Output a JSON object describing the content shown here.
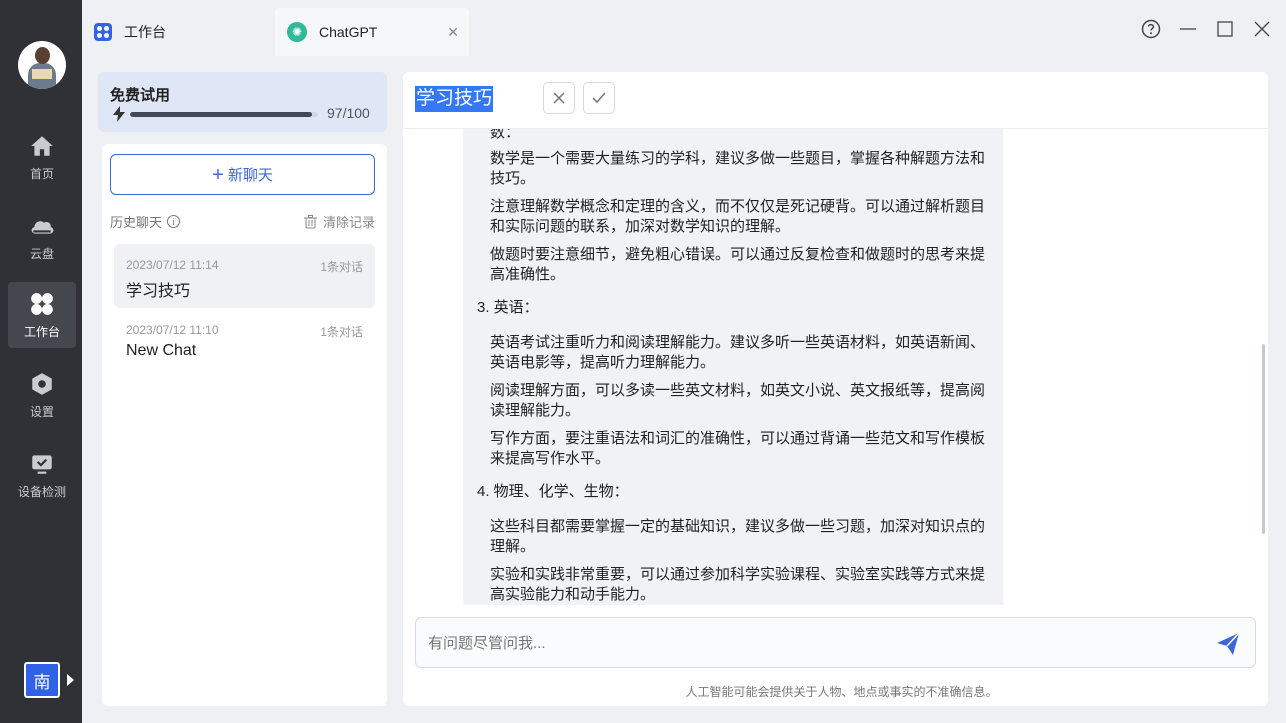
{
  "nav": {
    "items": [
      {
        "label": "首页",
        "icon": "home-icon"
      },
      {
        "label": "云盘",
        "icon": "cloud-icon"
      },
      {
        "label": "工作台",
        "icon": "workbench-icon"
      },
      {
        "label": "设置",
        "icon": "settings-icon"
      },
      {
        "label": "设备检测",
        "icon": "device-check-icon"
      }
    ],
    "active": "工作台",
    "bottom_badge": "南"
  },
  "tabs": [
    {
      "label": "工作台",
      "icon": "workbench-icon"
    },
    {
      "label": "ChatGPT",
      "icon": "chatgpt-icon"
    }
  ],
  "trial": {
    "title": "免费试用",
    "count": "97/100",
    "progress": 0.97
  },
  "chatlist": {
    "new_chat": "新聊天",
    "history_label": "历史聊天",
    "clear_label": "清除记录",
    "conversations": [
      {
        "date": "2023/07/12 11:14",
        "count": "1条对话",
        "name": "学习技巧"
      },
      {
        "date": "2023/07/12 11:10",
        "count": "1条对话",
        "name": "New Chat"
      }
    ]
  },
  "main": {
    "title": "学习技巧",
    "messages": {
      "cut_top": "数：",
      "p1": "数学是一个需要大量练习的学科，建议多做一些题目，掌握各种解题方法和技巧。",
      "p2": "注意理解数学概念和定理的含义，而不仅仅是死记硬背。可以通过解析题目和实际问题的联系，加深对数学知识的理解。",
      "p3": "做题时要注意细节，避免粗心错误。可以通过反复检查和做题时的思考来提高准确性。",
      "h3": "3. 英语：",
      "p4": "英语考试注重听力和阅读理解能力。建议多听一些英语材料，如英语新闻、英语电影等，提高听力理解能力。",
      "p5": "阅读理解方面，可以多读一些英文材料，如英文小说、英文报纸等，提高阅读理解能力。",
      "p6": "写作方面，要注重语法和词汇的准确性，可以通过背诵一些范文和写作模板来提高写作水平。",
      "h4": "4. 物理、化学、生物：",
      "p7": "这些科目都需要掌握一定的基础知识，建议多做一些习题，加深对知识点的理解。",
      "p8": "实验和实践非常重要，可以通过参加科学实验课程、实验室实践等方式来提高实验能力和动手能力。"
    },
    "input_placeholder": "有问题尽管问我...",
    "disclaimer": "人工智能可能会提供关于人物、地点或事实的不准确信息。"
  },
  "colors": {
    "accent": "#3d66d8",
    "nav_bg": "#2f3136",
    "title_highlight": "#3478f6",
    "chatgpt_green": "#2fb89a"
  }
}
